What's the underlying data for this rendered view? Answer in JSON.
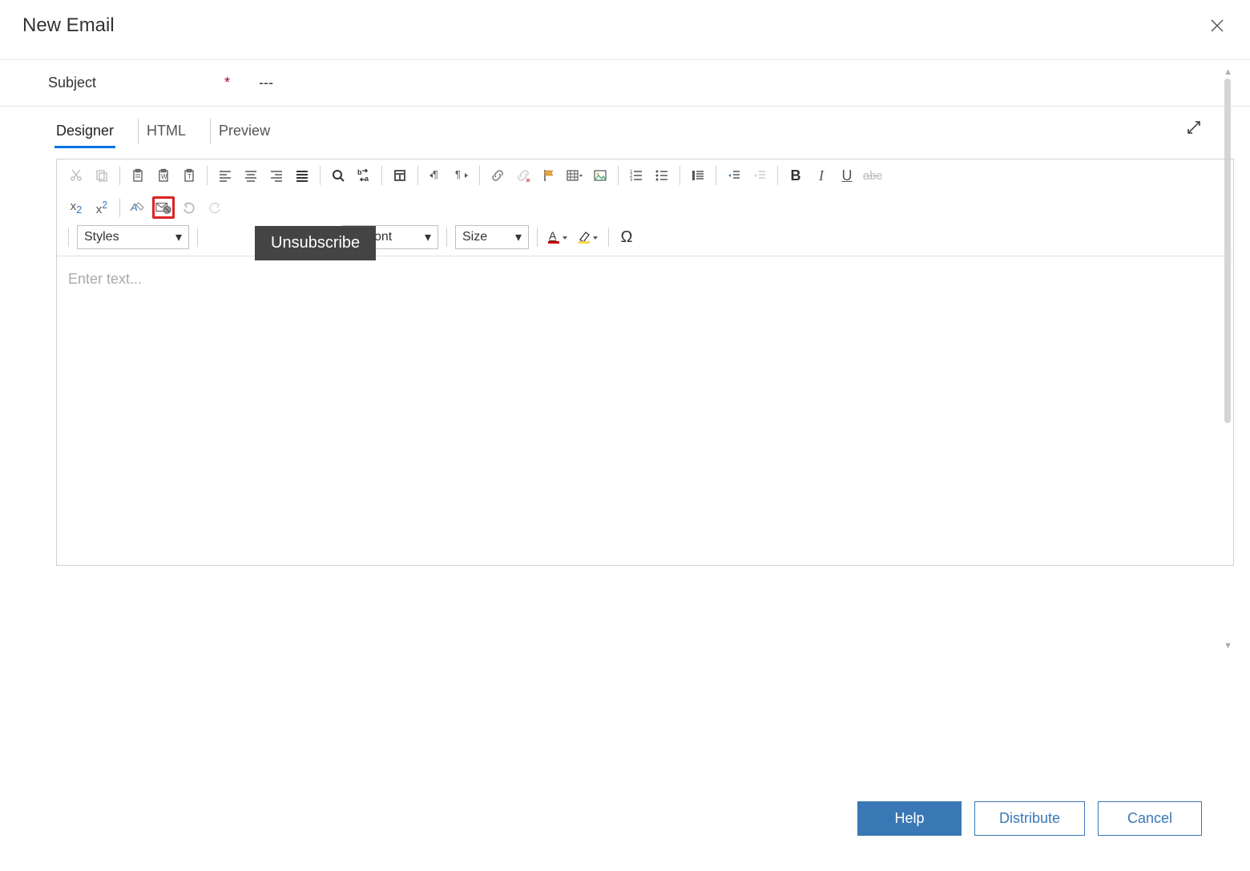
{
  "dialog": {
    "title": "New Email"
  },
  "subject": {
    "label": "Subject",
    "required_marker": "*",
    "value": "---"
  },
  "tabs": {
    "designer": "Designer",
    "html": "HTML",
    "preview": "Preview"
  },
  "tooltip": {
    "text": "Unsubscribe"
  },
  "dropdowns": {
    "styles_label": "Styles",
    "font_partial_label": "ont",
    "size_label": "Size"
  },
  "editor": {
    "placeholder": "Enter text..."
  },
  "footer": {
    "help": "Help",
    "distribute": "Distribute",
    "cancel": "Cancel"
  }
}
